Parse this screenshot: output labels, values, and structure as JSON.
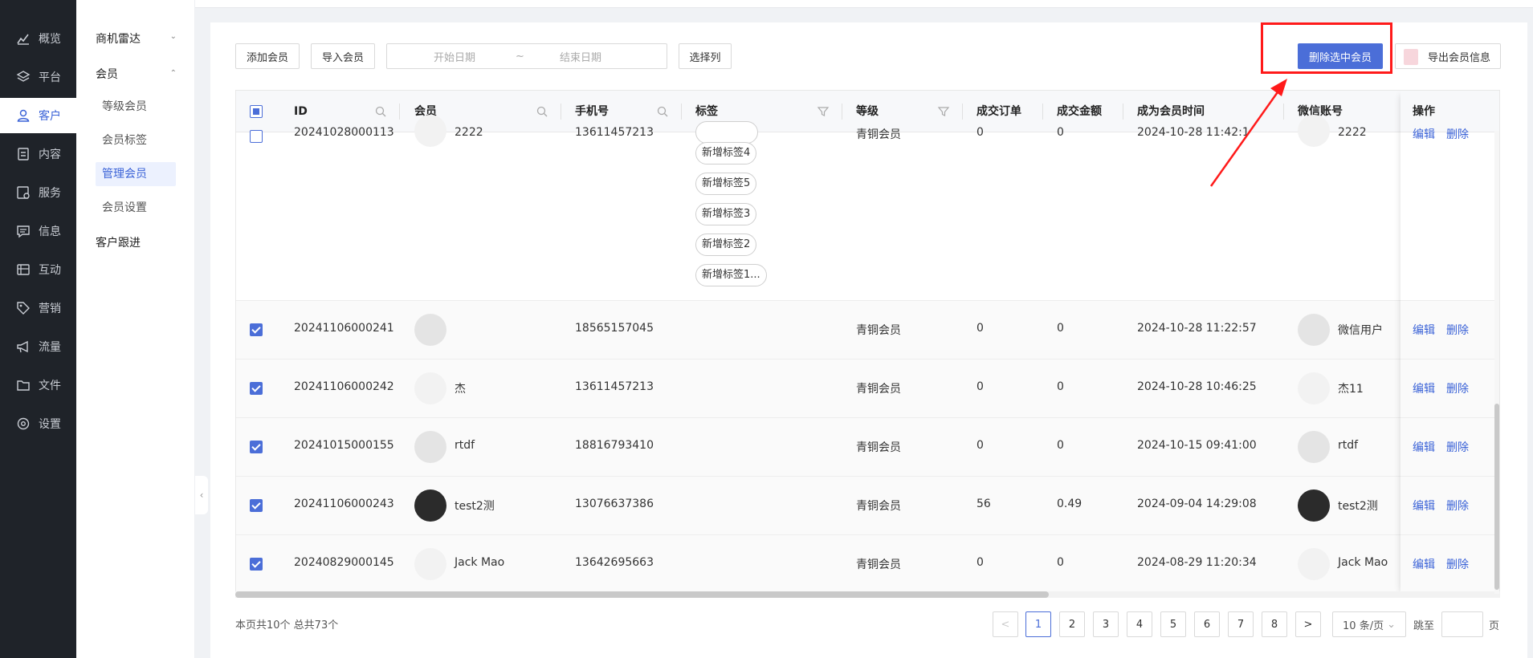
{
  "nav": {
    "items": [
      {
        "label": "概览",
        "icon": "chart-icon"
      },
      {
        "label": "平台",
        "icon": "layers-icon"
      },
      {
        "label": "客户",
        "icon": "user-icon"
      },
      {
        "label": "内容",
        "icon": "document-icon"
      },
      {
        "label": "服务",
        "icon": "service-icon"
      },
      {
        "label": "信息",
        "icon": "message-icon"
      },
      {
        "label": "互动",
        "icon": "interaction-icon"
      },
      {
        "label": "营销",
        "icon": "tag-icon"
      },
      {
        "label": "流量",
        "icon": "megaphone-icon"
      },
      {
        "label": "文件",
        "icon": "folder-icon"
      },
      {
        "label": "设置",
        "icon": "gear-icon"
      }
    ],
    "active": "客户"
  },
  "submenu": {
    "groups": [
      {
        "label": "商机雷达"
      },
      {
        "label": "会员",
        "children": [
          "等级会员",
          "会员标签",
          "管理会员",
          "会员设置"
        ]
      },
      {
        "label": "客户跟进"
      }
    ],
    "active": "管理会员"
  },
  "toolbar": {
    "add_member": "添加会员",
    "import_member": "导入会员",
    "date_start_placeholder": "开始日期",
    "date_separator": "~",
    "date_end_placeholder": "结束日期",
    "select_columns": "选择列",
    "delete_selected": "删除选中会员",
    "export_info": "导出会员信息"
  },
  "table": {
    "columns": [
      "ID",
      "会员",
      "手机号",
      "标签",
      "等级",
      "成交订单",
      "成交金额",
      "成为会员时间",
      "微信账号",
      "操作"
    ],
    "partial_row": {
      "id": "20241028000113",
      "member": "2222",
      "phone": "13611457213",
      "level": "青铜会员",
      "orders": "0",
      "amount": "0",
      "time": "2024-10-28 11:42:1",
      "wechat": "2222",
      "tags": [
        "新增标签4",
        "新增标签5",
        "新增标签3",
        "新增标签2",
        "新增标签1..."
      ],
      "edit": "编辑",
      "delete": "删除"
    },
    "rows": [
      {
        "id": "20241106000241",
        "member": "",
        "phone": "18565157045",
        "level": "青铜会员",
        "orders": "0",
        "amount": "0",
        "time": "2024-10-28 11:22:57",
        "wechat": "微信用户",
        "edit": "编辑",
        "delete": "删除"
      },
      {
        "id": "20241106000242",
        "member": "杰",
        "phone": "13611457213",
        "level": "青铜会员",
        "orders": "0",
        "amount": "0",
        "time": "2024-10-28 10:46:25",
        "wechat": "杰11",
        "edit": "编辑",
        "delete": "删除"
      },
      {
        "id": "20241015000155",
        "member": "rtdf",
        "phone": "18816793410",
        "level": "青铜会员",
        "orders": "0",
        "amount": "0",
        "time": "2024-10-15 09:41:00",
        "wechat": "rtdf",
        "edit": "编辑",
        "delete": "删除"
      },
      {
        "id": "20241106000243",
        "member": "test2测",
        "phone": "13076637386",
        "level": "青铜会员",
        "orders": "56",
        "amount": "0.49",
        "time": "2024-09-04 14:29:08",
        "wechat": "test2测",
        "edit": "编辑",
        "delete": "删除"
      },
      {
        "id": "20240829000145",
        "member": "Jack Mao",
        "phone": "13642695663",
        "level": "青铜会员",
        "orders": "0",
        "amount": "0",
        "time": "2024-08-29 11:20:34",
        "wechat": "Jack Mao",
        "edit": "编辑",
        "delete": "删除"
      }
    ]
  },
  "pagination": {
    "summary": "本页共10个 总共73个",
    "pages": [
      "1",
      "2",
      "3",
      "4",
      "5",
      "6",
      "7",
      "8"
    ],
    "current": "1",
    "prev": "<",
    "next": ">",
    "page_size": "10 条/页",
    "jump_label": "跳至",
    "jump_suffix": "页"
  },
  "annotation": {
    "color": "#ff1a1a"
  }
}
